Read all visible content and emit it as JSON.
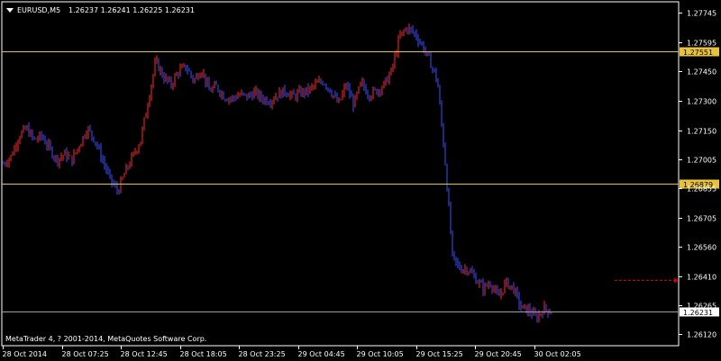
{
  "header": {
    "symbol": "EURUSD,M5",
    "ohlc": "1.26237 1.26241 1.26225 1.26231"
  },
  "copyright": "MetaTrader 4, ? 2001-2014, MetaQuotes Software Corp.",
  "colors": {
    "background": "#000000",
    "bull": "#ff2a2a",
    "bear": "#3c50ff",
    "level_line": "#e7c23c",
    "bid_line": "#a0a0a0",
    "arrow": "#d40000",
    "axis": "#ffffff"
  },
  "chart_data": {
    "type": "line",
    "title": "",
    "ylim": [
      1.2606,
      1.278
    ],
    "y_ticks": [
      "1.27745",
      "1.27595",
      "1.27450",
      "1.27300",
      "1.27150",
      "1.27005",
      "1.26855",
      "1.26705",
      "1.26560",
      "1.26410",
      "1.26265",
      "1.26120"
    ],
    "x_tick_labels": [
      "28 Oct 2014",
      "28 Oct 07:25",
      "28 Oct 12:45",
      "28 Oct 18:05",
      "28 Oct 23:25",
      "29 Oct 04:45",
      "29 Oct 10:05",
      "29 Oct 15:25",
      "29 Oct 20:45",
      "30 Oct 02:05"
    ],
    "levels": [
      {
        "name": "resistance",
        "value": 1.27551,
        "label": "1.27551"
      },
      {
        "name": "support",
        "value": 1.26879,
        "label": "1.26879"
      }
    ],
    "bid": {
      "value": 1.26231,
      "label": "1.26231"
    },
    "arrow_price": 1.26391,
    "price_series": [
      1.2698,
      1.2702,
      1.2712,
      1.2716,
      1.271,
      1.2712,
      1.2706,
      1.27,
      1.2703,
      1.27,
      1.2708,
      1.2716,
      1.271,
      1.27,
      1.269,
      1.2684,
      1.2694,
      1.2702,
      1.271,
      1.273,
      1.275,
      1.2742,
      1.2738,
      1.2745,
      1.2747,
      1.274,
      1.2746,
      1.2735,
      1.2737,
      1.2732,
      1.2731,
      1.2733,
      1.2732,
      1.2734,
      1.2731,
      1.273,
      1.2733,
      1.2735,
      1.2732,
      1.2734,
      1.2735,
      1.2738,
      1.274,
      1.2735,
      1.2728,
      1.2738,
      1.2728,
      1.2739,
      1.2733,
      1.2735,
      1.2738,
      1.2745,
      1.2762,
      1.2767,
      1.2764,
      1.2758,
      1.275,
      1.274,
      1.27,
      1.265,
      1.2645,
      1.2645,
      1.264,
      1.2635,
      1.2638,
      1.263,
      1.2638,
      1.2635,
      1.2625,
      1.2624,
      1.262,
      1.2625,
      1.2623
    ]
  }
}
